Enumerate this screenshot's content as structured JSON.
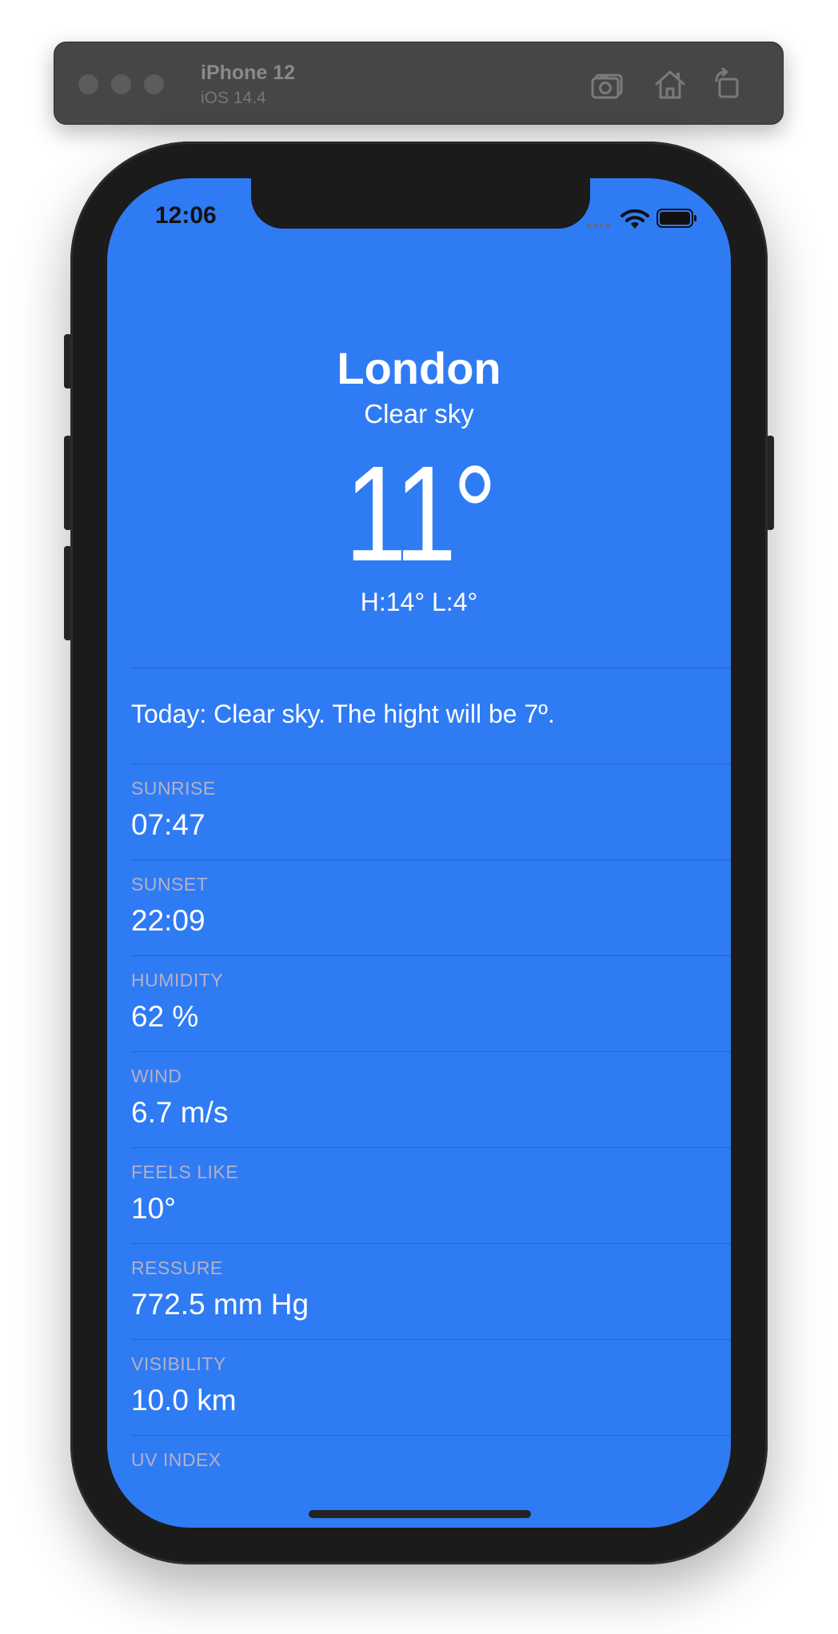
{
  "simulator": {
    "device_name": "iPhone 12",
    "os_version": "iOS 14.4",
    "buttons": [
      {
        "icon": "screenshot-icon"
      },
      {
        "icon": "home-icon"
      },
      {
        "icon": "rotate-icon"
      }
    ]
  },
  "status_bar": {
    "time": "12:06"
  },
  "weather": {
    "city": "London",
    "condition": "Clear sky",
    "temperature": "11°",
    "high_low": "H:14° L:4°",
    "summary": "Today: Clear sky. The hight will be 7º."
  },
  "details": [
    {
      "label": "SUNRISE",
      "value": "07:47"
    },
    {
      "label": "SUNSET",
      "value": "22:09"
    },
    {
      "label": "HUMIDITY",
      "value": "62 %"
    },
    {
      "label": "WIND",
      "value": "6.7 m/s"
    },
    {
      "label": "FEELS LIKE",
      "value": "10°"
    },
    {
      "label": "RESSURE",
      "value": "772.5 mm Hg"
    },
    {
      "label": "VISIBILITY",
      "value": "10.0 km"
    },
    {
      "label": "UV INDEX",
      "value": ""
    }
  ],
  "colors": {
    "screen_background": "#2f7bf4",
    "phone_frame": "#1b1b1b",
    "label_text": "#b6b0c6",
    "value_text": "#ffffff"
  }
}
